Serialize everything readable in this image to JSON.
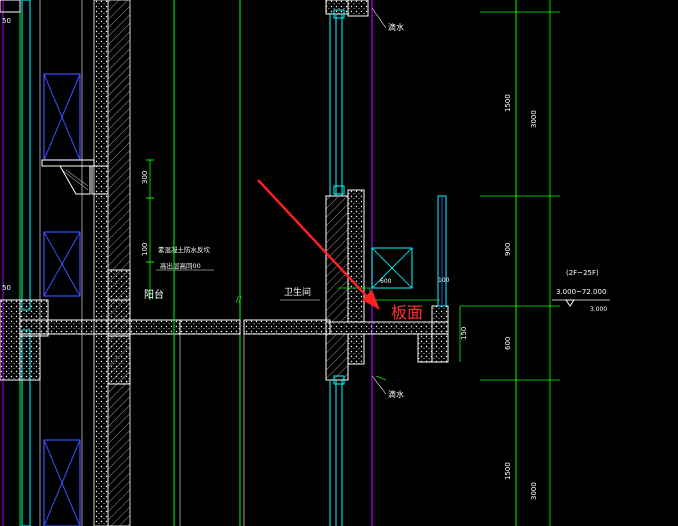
{
  "colors": {
    "background": "#000000",
    "wall": "#ffffff",
    "axis_green": "#00ff00",
    "purple": "#b000ff",
    "cyan": "#00ffff",
    "blue_window": "#3a4fff",
    "annotation_red": "#ff2020",
    "yellow_text": "#ffff66"
  },
  "labels": {
    "drip_top": "滴水",
    "drip_bottom": "滴水",
    "balcony": "阳台",
    "bathroom": "卫生间",
    "board_surface": "板面",
    "waterproof_line1": "素混凝土防水反坎",
    "waterproof_line2": "高出层高同00",
    "floor_range": "(2F~25F)",
    "elevations": "3.000~72.000",
    "elev_sub": "3.000"
  },
  "dimensions": {
    "d1500_top": "1500",
    "d3000_top": "3000",
    "d900": "900",
    "d600": "600",
    "d1500_bottom": "1500",
    "d3000_bottom": "3000",
    "d300_left": "300",
    "d100_left": "100",
    "d50_top": "50",
    "d50_mid": "50",
    "d150": "150",
    "d600_small": "600",
    "d100_small": "100"
  }
}
